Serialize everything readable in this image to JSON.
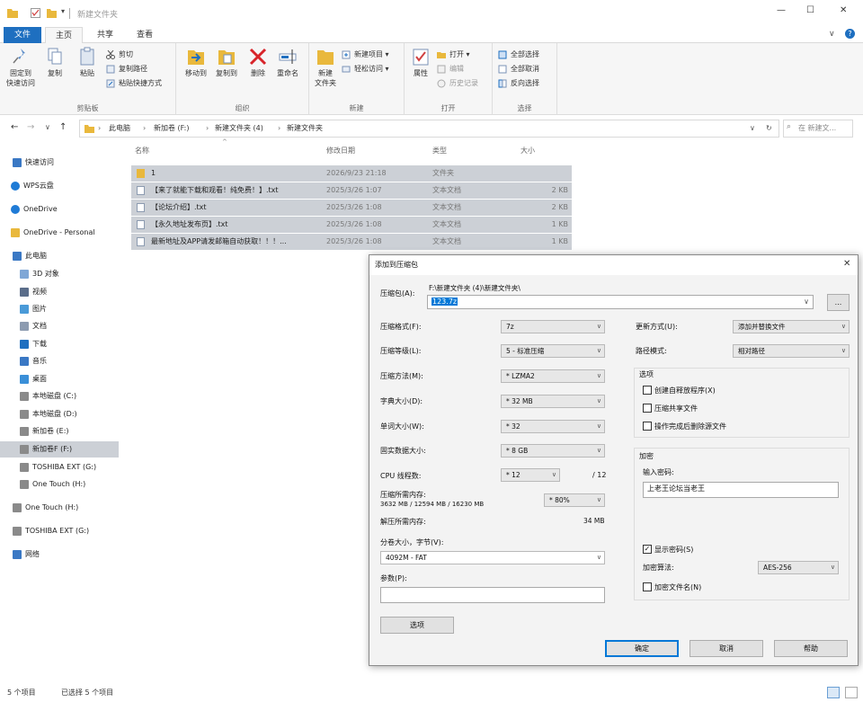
{
  "window": {
    "title": "新建文件夹"
  },
  "ribbon_tabs": [
    "文件",
    "主页",
    "共享",
    "查看"
  ],
  "ribbon": {
    "clipboard": {
      "pin": "固定到\n快速访问",
      "copy": "复制",
      "paste": "粘贴",
      "cut": "剪切",
      "copy_path": "复制路径",
      "paste_shortcut": "粘贴快捷方式",
      "label": "剪贴板"
    },
    "organize": {
      "move_to": "移动到",
      "copy_to": "复制到",
      "delete": "删除",
      "rename": "重命名",
      "label": "组织"
    },
    "new": {
      "new_folder": "新建\n文件夹",
      "new_item": "新建项目",
      "easy_access": "轻松访问",
      "label": "新建"
    },
    "open": {
      "properties": "属性",
      "open": "打开",
      "edit": "编辑",
      "history": "历史记录",
      "label": "打开"
    },
    "select": {
      "select_all": "全部选择",
      "select_none": "全部取消",
      "invert": "反向选择",
      "label": "选择"
    }
  },
  "address": {
    "crumbs": [
      "此电脑",
      "新加卷 (F:)",
      "新建文件夹 (4)",
      "新建文件夹"
    ],
    "search_placeholder": "在 新建文..."
  },
  "nav": [
    {
      "label": "快速访问",
      "icon": "star-icon"
    },
    {
      "label": "WPS云盘",
      "icon": "cloud-icon"
    },
    {
      "label": "OneDrive",
      "icon": "cloud-icon"
    },
    {
      "label": "OneDrive - Personal",
      "icon": "folder-icon"
    },
    {
      "label": "此电脑",
      "icon": "computer-icon"
    },
    {
      "label": "3D 对象",
      "icon": "cube-icon"
    },
    {
      "label": "视频",
      "icon": "video-icon"
    },
    {
      "label": "图片",
      "icon": "picture-icon"
    },
    {
      "label": "文档",
      "icon": "document-icon"
    },
    {
      "label": "下载",
      "icon": "download-icon"
    },
    {
      "label": "音乐",
      "icon": "music-icon"
    },
    {
      "label": "桌面",
      "icon": "desktop-icon"
    },
    {
      "label": "本地磁盘 (C:)",
      "icon": "drive-icon"
    },
    {
      "label": "本地磁盘 (D:)",
      "icon": "drive-icon"
    },
    {
      "label": "新加卷 (E:)",
      "icon": "drive-icon"
    },
    {
      "label": "新加卷F (F:)",
      "icon": "drive-icon"
    },
    {
      "label": "TOSHIBA EXT (G:)",
      "icon": "drive-icon"
    },
    {
      "label": "One Touch (H:)",
      "icon": "drive-icon"
    },
    {
      "label": "One Touch (H:)",
      "icon": "drive-icon"
    },
    {
      "label": "TOSHIBA EXT (G:)",
      "icon": "drive-icon"
    },
    {
      "label": "网络",
      "icon": "network-icon"
    }
  ],
  "columns": [
    "名称",
    "修改日期",
    "类型",
    "大小"
  ],
  "files": [
    {
      "name": "1",
      "date": "2026/9/23 21:18",
      "type": "文件夹",
      "size": "",
      "icon": "folder-icon"
    },
    {
      "name": "【来了就能下载和观看！纯免费！】.txt",
      "date": "2025/3/26 1:07",
      "type": "文本文档",
      "size": "2 KB",
      "icon": "text-file-icon"
    },
    {
      "name": "【论坛介绍】.txt",
      "date": "2025/3/26 1:08",
      "type": "文本文档",
      "size": "2 KB",
      "icon": "text-file-icon"
    },
    {
      "name": "【永久地址发布页】.txt",
      "date": "2025/3/26 1:08",
      "type": "文本文档",
      "size": "1 KB",
      "icon": "text-file-icon"
    },
    {
      "name": "最新地址及APP请发邮箱自动获取！！！...",
      "date": "2025/3/26 1:08",
      "type": "文本文档",
      "size": "1 KB",
      "icon": "text-file-icon"
    }
  ],
  "status": {
    "count": "5 个项目",
    "selected": "已选择 5 个项目"
  },
  "dialog": {
    "title": "添加到压缩包",
    "archive_label": "压缩包(A):",
    "archive_path": "F:\\新建文件夹 (4)\\新建文件夹\\",
    "archive_name": "123.7z",
    "browse": "...",
    "format_label": "压缩格式(F):",
    "format": "7z",
    "level_label": "压缩等级(L):",
    "level": "5 - 标准压缩",
    "method_label": "压缩方法(M):",
    "method": "* LZMA2",
    "dict_label": "字典大小(D):",
    "dict": "* 32 MB",
    "word_label": "单词大小(W):",
    "word": "* 32",
    "solid_label": "固实数据大小:",
    "solid": "* 8 GB",
    "cpu_label": "CPU 线程数:",
    "cpu": "* 12",
    "cpu_total": "/ 12",
    "mem_label": "压缩所需内存:",
    "mem_value": "3632 MB / 12594 MB / 16230 MB",
    "mem_pct": "* 80%",
    "decomp_label": "解压所需内存:",
    "decomp_value": "34 MB",
    "split_label": "分卷大小，字节(V):",
    "split": "4092M - FAT",
    "params_label": "参数(P):",
    "params": "",
    "options_btn": "选项",
    "update_label": "更新方式(U):",
    "update": "添加并替换文件",
    "path_label": "路径模式:",
    "path_mode": "相对路径",
    "options_group": "选项",
    "opt_sfx": "创建自释放程序(X)",
    "opt_shared": "压缩共享文件",
    "opt_delete": "操作完成后删除源文件",
    "enc_group": "加密",
    "pwd_label": "输入密码:",
    "pwd_value": "上老王论坛当老王",
    "show_pwd": "显示密码(S)",
    "enc_method_label": "加密算法:",
    "enc_method": "AES-256",
    "enc_names": "加密文件名(N)",
    "ok": "确定",
    "cancel": "取消",
    "help": "帮助"
  },
  "colors": {
    "accent": "#1e6fc0",
    "selection": "#ccd0d6",
    "folder": "#e9b83c"
  }
}
